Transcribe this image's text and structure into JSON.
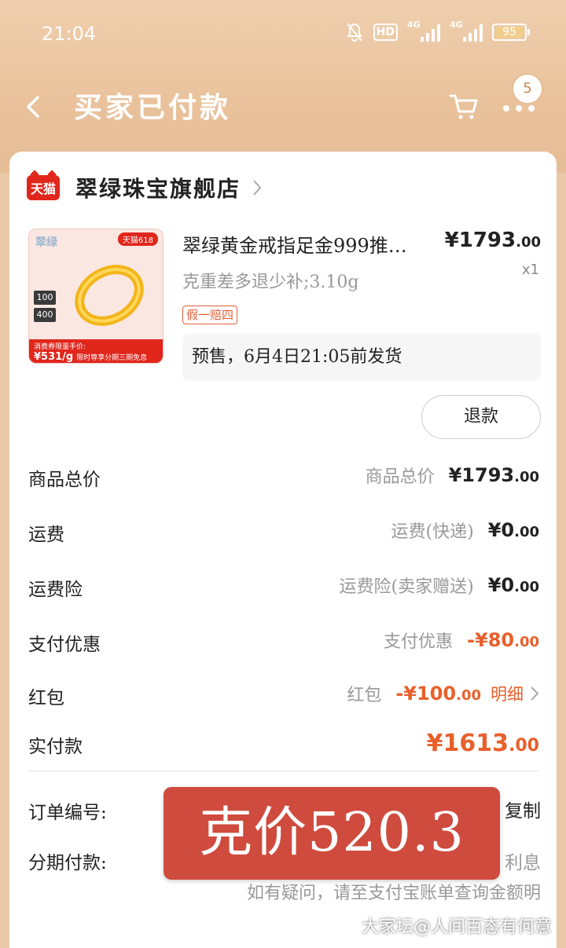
{
  "status": {
    "time": "21:04",
    "hd": "HD",
    "signal1_label": "4G",
    "signal2_label": "4G",
    "battery": "95"
  },
  "nav": {
    "title": "买家已付款",
    "badge_count": "5"
  },
  "shop": {
    "logo_text": "天猫",
    "name": "翠绿珠宝旗舰店"
  },
  "product": {
    "image": {
      "brand": "翠绿",
      "tag": "天猫618",
      "coupon1": "100",
      "coupon2": "400",
      "footer_line1": "消费券限量手价:",
      "footer_price": "¥531/g",
      "footer_line2": "限时尊享分期三期免息"
    },
    "name": "翠绿黄金戒指足金999推…",
    "price_int": "¥1793",
    "price_dec": ".00",
    "qty": "x1",
    "spec": "克重差多退少补;3.10g",
    "promise_tag": "假一赔四",
    "presale": "预售，6月4日21:05前发货",
    "refund_label": "退款"
  },
  "fees": [
    {
      "label": "商品总价",
      "desc": "商品总价",
      "amt_int": "¥1793",
      "amt_dec": ".00"
    },
    {
      "label": "运费",
      "desc": "运费(快递)",
      "amt_int": "¥0",
      "amt_dec": ".00"
    },
    {
      "label": "运费险",
      "desc": "运费险(卖家赠送)",
      "amt_int": "¥0",
      "amt_dec": ".00"
    },
    {
      "label": "支付优惠",
      "desc": "支付优惠",
      "amt_int": "-¥80",
      "amt_dec": ".00"
    },
    {
      "label": "红包",
      "desc": "红包",
      "amt_int": "-¥100",
      "amt_dec": ".00",
      "link": "明细"
    }
  ],
  "total": {
    "label": "实付款",
    "amt_int": "¥1613",
    "amt_dec": ".00"
  },
  "order_info": {
    "order_no_label": "订单编号:",
    "copy_label": "复制",
    "installment_label": "分期付款:",
    "interest_text": "利息",
    "hint_text": "如有疑问，请至支付宝账单查询金额明"
  },
  "overlay": {
    "text": "克价520.3"
  },
  "watermark": "大家坛@人间百态有何意",
  "colors": {
    "header": "#e9c29c",
    "accent": "#e8602c",
    "tmall_red": "#e1261c",
    "banner": "#cf4b3e"
  }
}
